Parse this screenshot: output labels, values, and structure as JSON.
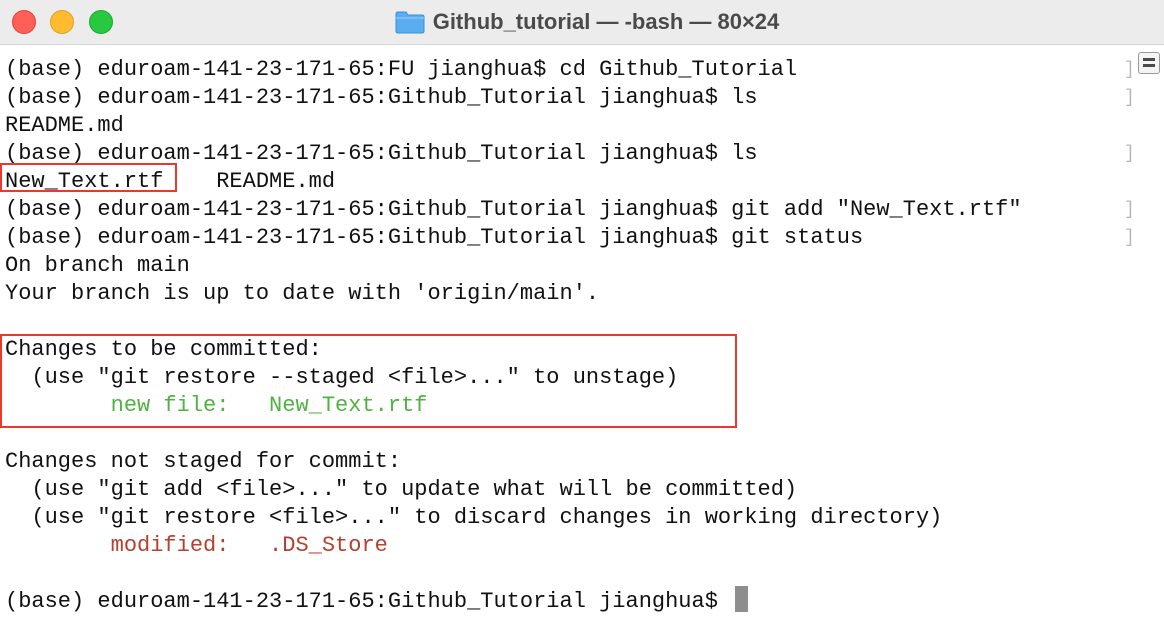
{
  "window": {
    "title": "Github_tutorial — -bash — 80×24",
    "folder_icon": "folder-icon"
  },
  "terminal": {
    "lines": [
      {
        "text": "(base) eduroam-141-23-171-65:FU jianghua$ cd Github_Tutorial",
        "bracket": "]"
      },
      {
        "text": "(base) eduroam-141-23-171-65:Github_Tutorial jianghua$ ls",
        "bracket": "]"
      },
      {
        "text": "README.md",
        "bracket": ""
      },
      {
        "text": "(base) eduroam-141-23-171-65:Github_Tutorial jianghua$ ls",
        "bracket": "]"
      },
      {
        "text": "New_Text.rtf    README.md",
        "bracket": ""
      },
      {
        "text": "(base) eduroam-141-23-171-65:Github_Tutorial jianghua$ git add \"New_Text.rtf\"",
        "bracket": "]"
      },
      {
        "text": "(base) eduroam-141-23-171-65:Github_Tutorial jianghua$ git status",
        "bracket": "]"
      },
      {
        "text": "On branch main",
        "bracket": ""
      },
      {
        "text": "Your branch is up to date with 'origin/main'.",
        "bracket": ""
      },
      {
        "text": "",
        "bracket": ""
      },
      {
        "text": "Changes to be committed:",
        "bracket": ""
      },
      {
        "text": "  (use \"git restore --staged <file>...\" to unstage)",
        "bracket": ""
      },
      {
        "text": "        new file:   New_Text.rtf",
        "bracket": "",
        "color": "green"
      },
      {
        "text": "",
        "bracket": ""
      },
      {
        "text": "Changes not staged for commit:",
        "bracket": ""
      },
      {
        "text": "  (use \"git add <file>...\" to update what will be committed)",
        "bracket": ""
      },
      {
        "text": "  (use \"git restore <file>...\" to discard changes in working directory)",
        "bracket": ""
      },
      {
        "text": "        modified:   .DS_Store",
        "bracket": "",
        "color": "red"
      },
      {
        "text": "",
        "bracket": ""
      },
      {
        "text": "(base) eduroam-141-23-171-65:Github_Tutorial jianghua$ ",
        "bracket": "",
        "cursor": true
      }
    ]
  },
  "colors": {
    "highlight_border": "#e8392a",
    "staged_text": "#4fb241",
    "unstaged_text": "#b5402d"
  }
}
